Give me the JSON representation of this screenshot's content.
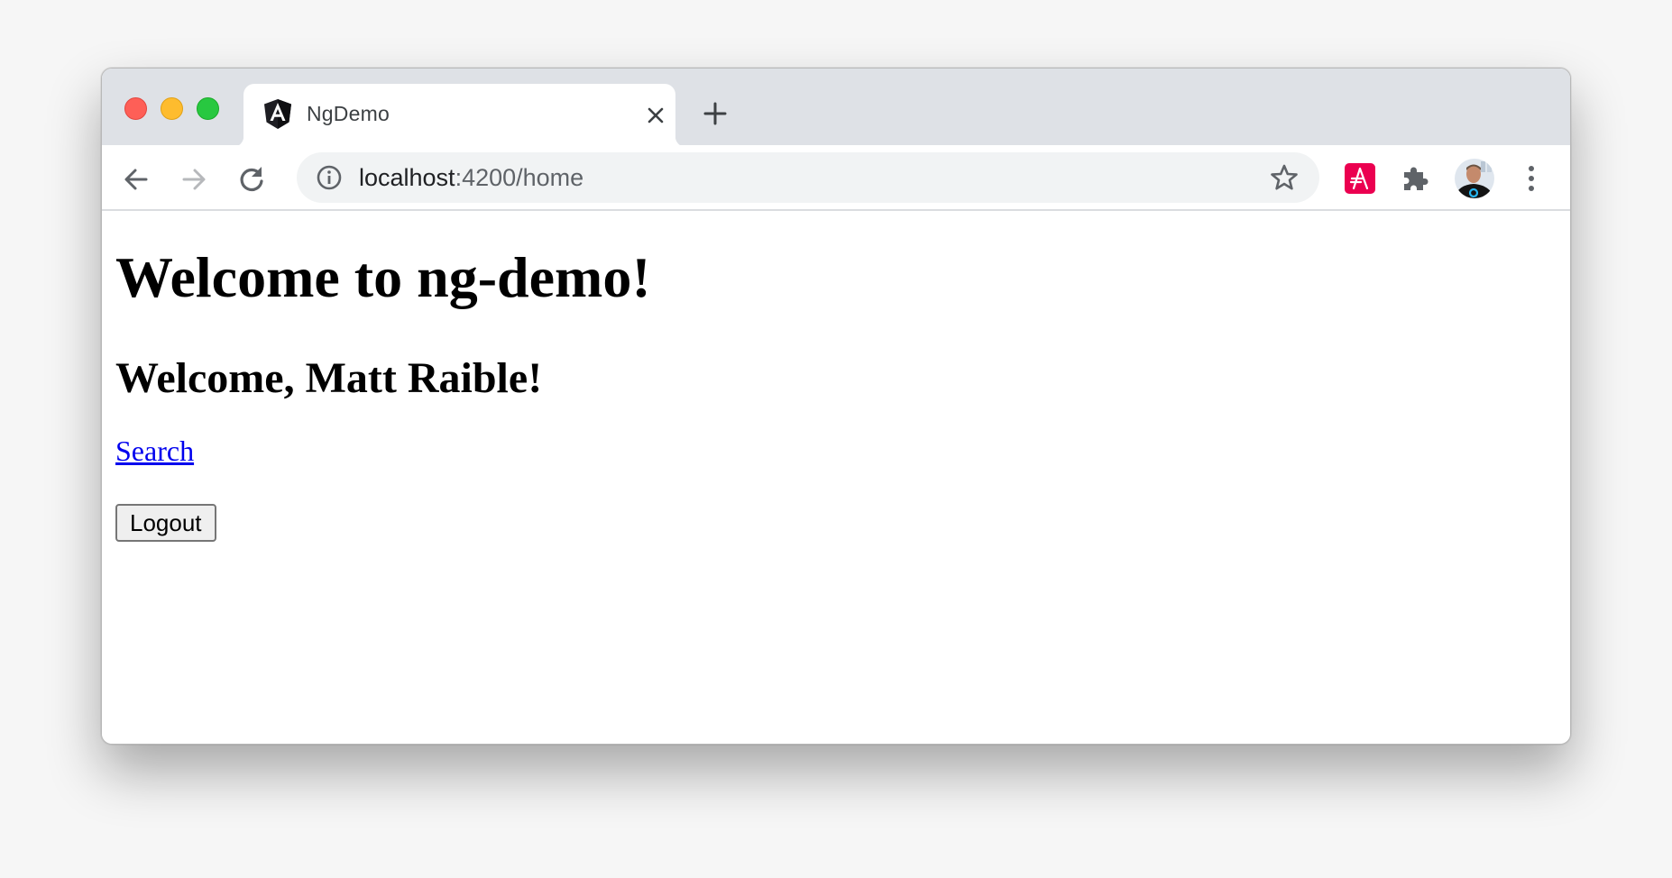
{
  "browser": {
    "tab": {
      "title": "NgDemo",
      "favicon": "angular-logo-icon"
    },
    "omnibox": {
      "host": "localhost",
      "path": ":4200/home",
      "security_icon": "info-icon"
    },
    "extensions": [
      {
        "name": "auth0-extension-icon",
        "color": "#eb0050"
      },
      {
        "name": "puzzle-extensions-icon"
      }
    ],
    "profile": "avatar",
    "colors": {
      "tabstrip": "#dee1e6",
      "omnibox": "#f1f3f4",
      "icon": "#5f6368"
    }
  },
  "page": {
    "title": "Welcome to ng-demo!",
    "greeting": "Welcome, Matt Raible!",
    "search_link": "Search",
    "logout_button": "Logout",
    "link_color": "#0000ee"
  }
}
